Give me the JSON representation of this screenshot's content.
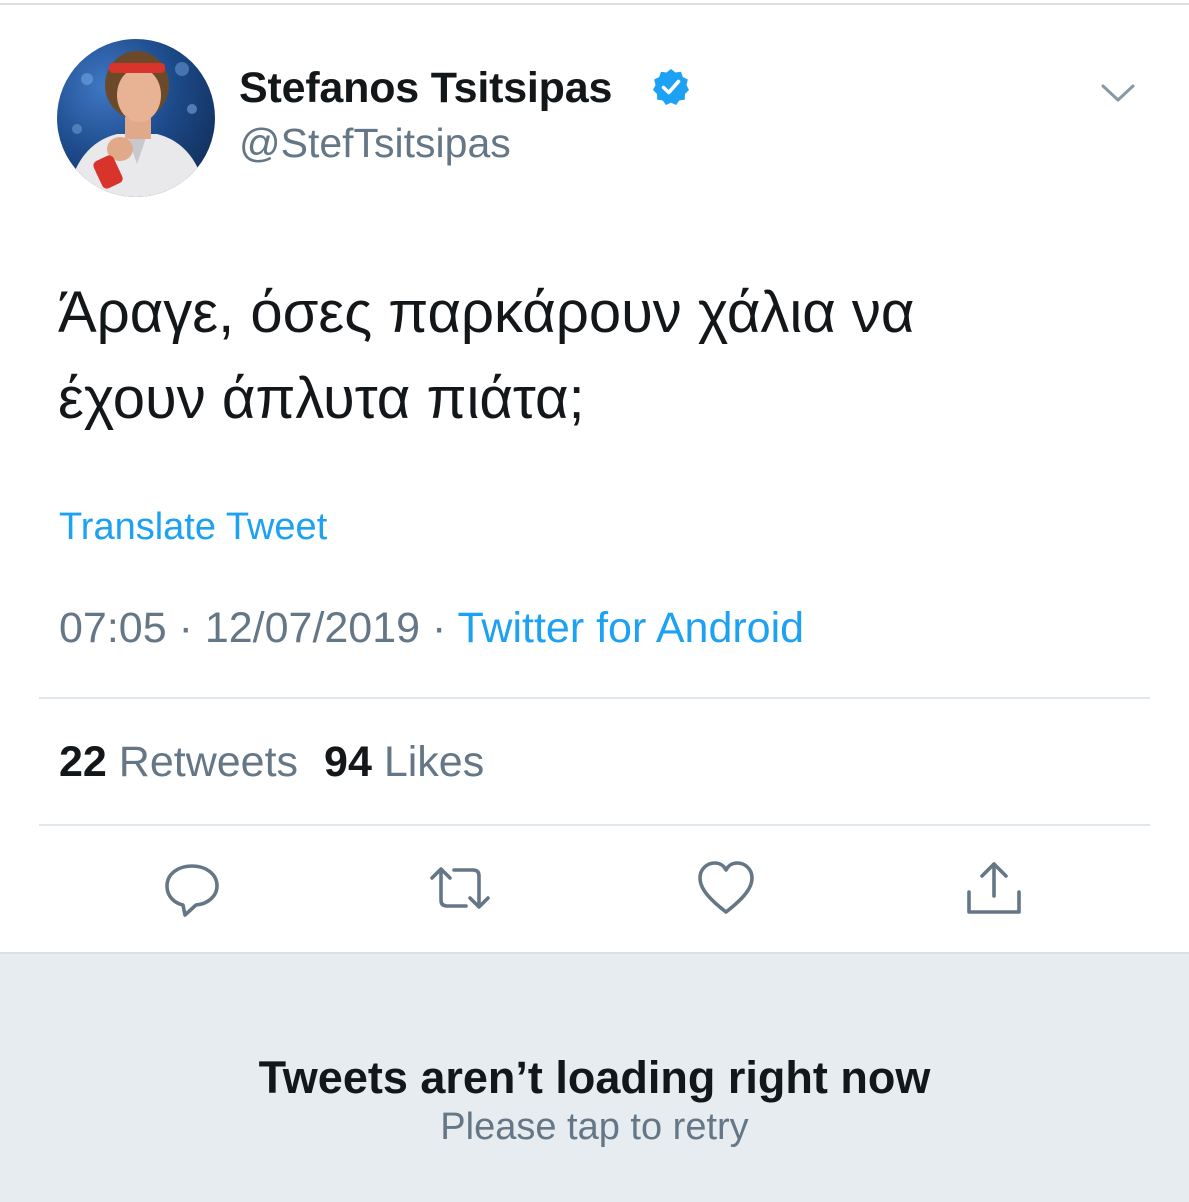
{
  "tweet": {
    "author": {
      "display_name": "Stefanos Tsitsipas",
      "handle": "@StefTsitsipas",
      "verified": true,
      "avatar_icon": "profile-photo"
    },
    "text_lines": [
      "Άραγε, όσες παρκάρουν χάλια να",
      "έχουν άπλυτα πιάτα;"
    ],
    "translate_label": "Translate Tweet",
    "time": "07:05",
    "date": "12/07/2019",
    "separator": "·",
    "source": "Twitter for Android",
    "stats": {
      "retweets_count": "22",
      "retweets_label": "Retweets",
      "likes_count": "94",
      "likes_label": "Likes"
    },
    "actions": {
      "reply_icon": "reply-icon",
      "retweet_icon": "retweet-icon",
      "like_icon": "heart-icon",
      "share_icon": "share-icon"
    }
  },
  "error_banner": {
    "title": "Tweets aren’t loading right now",
    "subtitle": "Please tap to retry"
  },
  "colors": {
    "accent": "#1da1f2",
    "text_primary": "#14171a",
    "text_secondary": "#657786",
    "divider": "#e1e8ed",
    "banner_bg": "#e6ecf0"
  }
}
